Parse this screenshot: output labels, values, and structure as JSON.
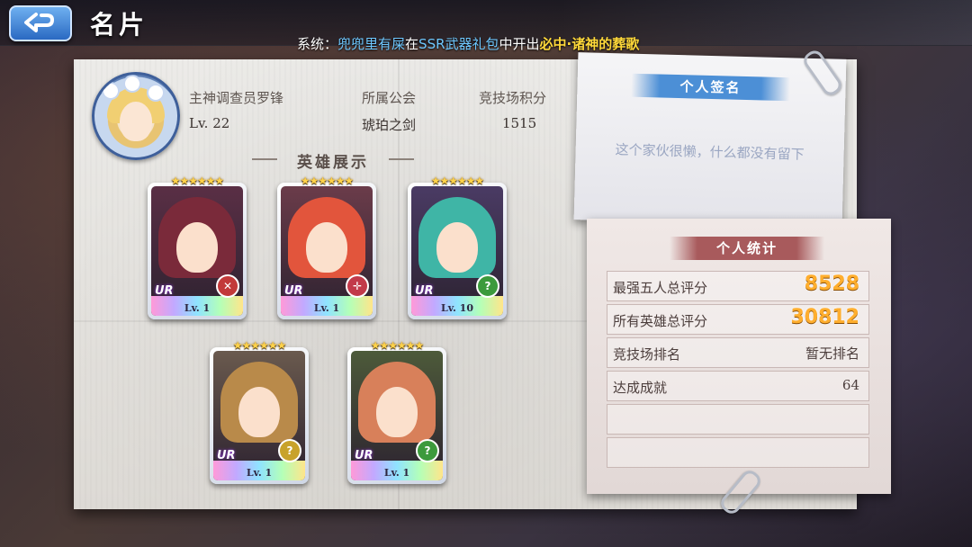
{
  "header": {
    "title": "名片",
    "ticker": {
      "prefix": "系统：",
      "player": "兜兜里有屎",
      "mid1": "在",
      "pack": "SSR武器礼包",
      "mid2": "中开出",
      "item": "必中·诸神的葬歌"
    }
  },
  "profile": {
    "name": "主神调查员罗锋",
    "level": "Lv. 22",
    "guild_label": "所属公会",
    "guild_value": "琥珀之剑",
    "arena_label": "竞技场积分",
    "arena_value": "1515"
  },
  "heroes": {
    "section_title": "英雄展示",
    "cards": [
      {
        "stars": "★★★★★★",
        "rarity": "UR",
        "level": "Lv. 1",
        "hair": "#7a2a3a",
        "bg": "#5a2f45",
        "badge": "✕",
        "badge_color": "#c23a3a"
      },
      {
        "stars": "★★★★★★",
        "rarity": "UR",
        "level": "Lv. 1",
        "hair": "#e2553c",
        "bg": "#6b3c4a",
        "badge": "✛",
        "badge_color": "#c23a4a"
      },
      {
        "stars": "★★★★★★",
        "rarity": "UR",
        "level": "Lv. 10",
        "hair": "#3fb5a6",
        "bg": "#4a3b64",
        "badge": "?",
        "badge_color": "#3c9a3c"
      },
      {
        "stars": "★★★★★★",
        "rarity": "UR",
        "level": "Lv. 1",
        "hair": "#b98a4a",
        "bg": "#6a5a4e",
        "badge": "?",
        "badge_color": "#c8a22a"
      },
      {
        "stars": "★★★★★★",
        "rarity": "UR",
        "level": "Lv. 1",
        "hair": "#d8805a",
        "bg": "#4d5a3a",
        "badge": "?",
        "badge_color": "#3c9a3c"
      }
    ]
  },
  "signature": {
    "title": "个人签名",
    "text": "这个家伙很懒，什么都没有留下"
  },
  "stats": {
    "title": "个人统计",
    "rows": [
      {
        "label": "最强五人总评分",
        "value": "8528"
      },
      {
        "label": "所有英雄总评分",
        "value": "30812"
      },
      {
        "label": "竞技场排名",
        "value": "暂无排名"
      },
      {
        "label": "达成成就",
        "value": "64"
      },
      {
        "label": "",
        "value": ""
      },
      {
        "label": "",
        "value": ""
      }
    ]
  }
}
